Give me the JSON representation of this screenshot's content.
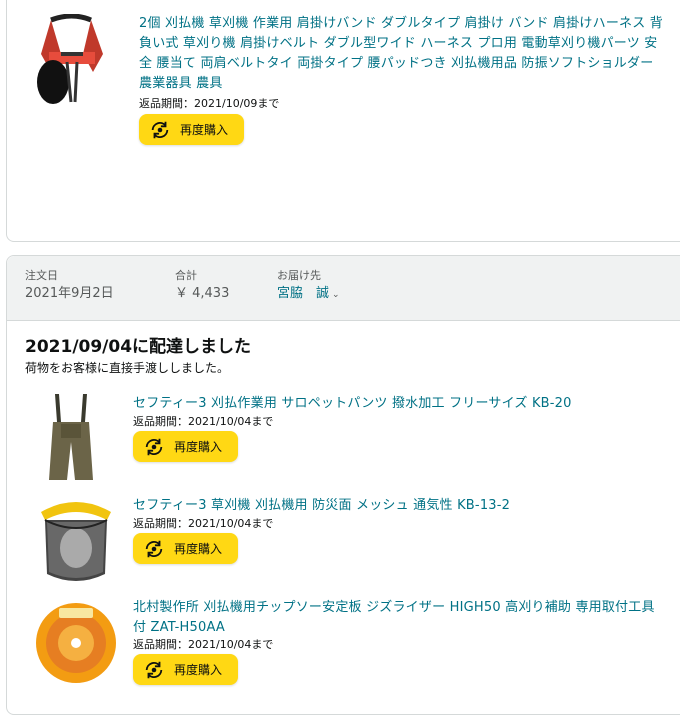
{
  "top_item": {
    "title": "2個 刈払機 草刈機 作業用 肩掛けバンド ダブルタイプ 肩掛け バンド 肩掛けハーネス 背負い式 草刈り機 肩掛けベルト ダブル型ワイド ハーネス プロ用 電動草刈り機パーツ 安全 腰当て 両肩ベルトタイ 両掛タイプ 腰パッドつき 刈払機用品 防振ソフトショルダー 農業器具 農具",
    "return_period": "返品期間：2021/10/09まで",
    "rebuy_label": "再度購入"
  },
  "order": {
    "date_label": "注文日",
    "date_value": "2021年9月2日",
    "total_label": "合計",
    "total_value": "￥ 4,433",
    "ship_label": "お届け先",
    "ship_value": "宮脇　誠"
  },
  "delivery": {
    "status": "2021/09/04に配達しました",
    "note": "荷物をお客様に直接手渡ししました。"
  },
  "items": [
    {
      "title": "セフティー3 刈払作業用 サロペットパンツ 撥水加工 フリーサイズ KB-20",
      "return_period": "返品期間：2021/10/04まで",
      "rebuy_label": "再度購入"
    },
    {
      "title": "セフティー3 草刈機 刈払機用 防災面 メッシュ 通気性 KB-13-2",
      "return_period": "返品期間：2021/10/04まで",
      "rebuy_label": "再度購入"
    },
    {
      "title": "北村製作所 刈払機用チップソー安定板 ジズライザー HIGH50 高刈り補助 専用取付工具付 ZAT-H50AA",
      "return_period": "返品期間：2021/10/04まで",
      "rebuy_label": "再度購入"
    }
  ]
}
